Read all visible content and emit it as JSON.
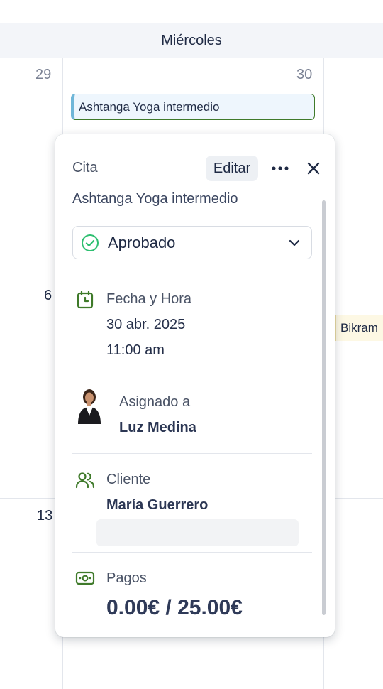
{
  "calendar": {
    "day_header": "Miércoles",
    "day_numbers": [
      "29",
      "30",
      "6",
      "13"
    ],
    "events": [
      {
        "title": "Ashtanga Yoga intermedio"
      },
      {
        "title": "Bikram"
      }
    ]
  },
  "popover": {
    "title": "Cita",
    "edit_label": "Editar",
    "more_icon": "more-horizontal-icon",
    "close_icon": "close-icon",
    "subject": "Ashtanga Yoga intermedio",
    "status": {
      "value": "Aprobado",
      "icon": "check-circle-icon",
      "color": "#2fbf71"
    },
    "datetime": {
      "label": "Fecha y Hora",
      "date": "30 abr. 2025",
      "time": "11:00 am",
      "icon": "calendar-clock-icon"
    },
    "assigned": {
      "label": "Asignado a",
      "name": "Luz Medina"
    },
    "client": {
      "label": "Cliente",
      "name": "María Guerrero",
      "icon": "users-icon"
    },
    "payments": {
      "label": "Pagos",
      "total": "0.00€ / 25.00€",
      "icon": "cash-icon"
    }
  },
  "colors": {
    "accent_green": "#3f7a2a",
    "event_bg": "#eef6fd",
    "header_bg": "#f3f5f9"
  }
}
